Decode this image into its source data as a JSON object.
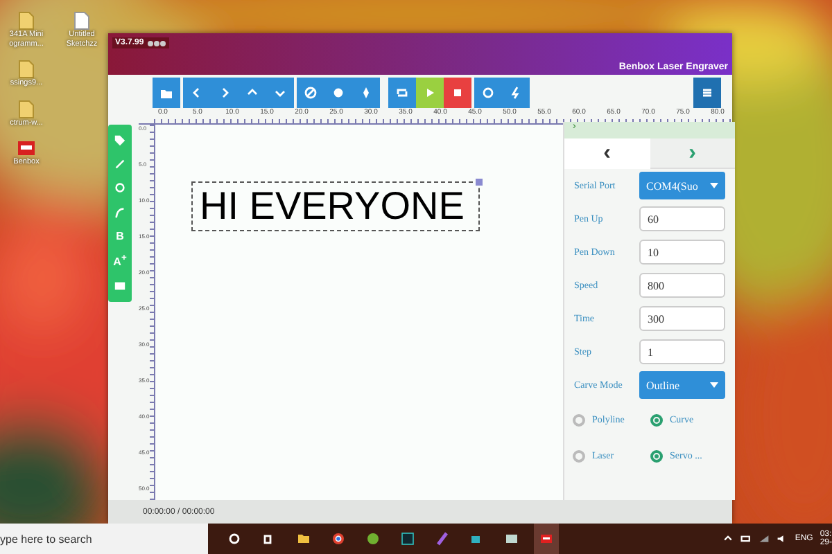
{
  "desktop_icons": [
    {
      "label": "341A Mini ogramm...",
      "kind": "file"
    },
    {
      "label": "ssings9...",
      "kind": "file"
    },
    {
      "label": "ctrum-w...",
      "kind": "file"
    },
    {
      "label": "Benbox",
      "kind": "app"
    },
    {
      "label": "Untitled Sketchzz",
      "kind": "doc"
    }
  ],
  "window": {
    "version": "V3.7.99",
    "title": "Benbox Laser Engraver"
  },
  "text_tools": [
    "B",
    "A$^{+}$"
  ],
  "ruler": {
    "x_labels": [
      "0.0",
      "5.0",
      "10.0",
      "15.0",
      "20.0",
      "25.0",
      "30.0",
      "35.0",
      "40.0",
      "45.0",
      "50.0",
      "55.0",
      "60.0",
      "65.0",
      "70.0",
      "75.0",
      "80.0"
    ],
    "y_labels": [
      "0.0",
      "5.0",
      "10.0",
      "15.0",
      "20.0",
      "25.0",
      "30.0",
      "35.0",
      "40.0",
      "45.0",
      "50.0"
    ]
  },
  "canvas": {
    "text": "HI EVERYONE"
  },
  "panel": {
    "header": "›",
    "tabs": [
      {
        "label": "‹",
        "selected": true
      },
      {
        "label": "›",
        "selected": false
      }
    ],
    "fields": [
      {
        "label": "Serial Port",
        "kind": "select",
        "value": "COM4(Suo"
      },
      {
        "label": "Pen Up",
        "kind": "input",
        "value": "60"
      },
      {
        "label": "Pen Down",
        "kind": "input",
        "value": "10"
      },
      {
        "label": "Speed",
        "kind": "input",
        "value": "800"
      },
      {
        "label": "Time",
        "kind": "input",
        "value": "300"
      },
      {
        "label": "Step",
        "kind": "input",
        "value": "1"
      },
      {
        "label": "Carve Mode",
        "kind": "select",
        "value": "Outline"
      }
    ],
    "radio_rows": [
      [
        {
          "label": "Polyline",
          "selected": false
        },
        {
          "label": "Curve",
          "selected": true
        }
      ],
      [
        {
          "label": "Laser",
          "selected": false
        },
        {
          "label": "Servo ...",
          "selected": true
        }
      ]
    ]
  },
  "status_bar": {
    "time": "00:00:00 / 00:00:00"
  },
  "taskbar": {
    "search_placeholder": "ype here to search",
    "language": "ENG",
    "clock_time": "03:",
    "clock_date": "29-"
  }
}
